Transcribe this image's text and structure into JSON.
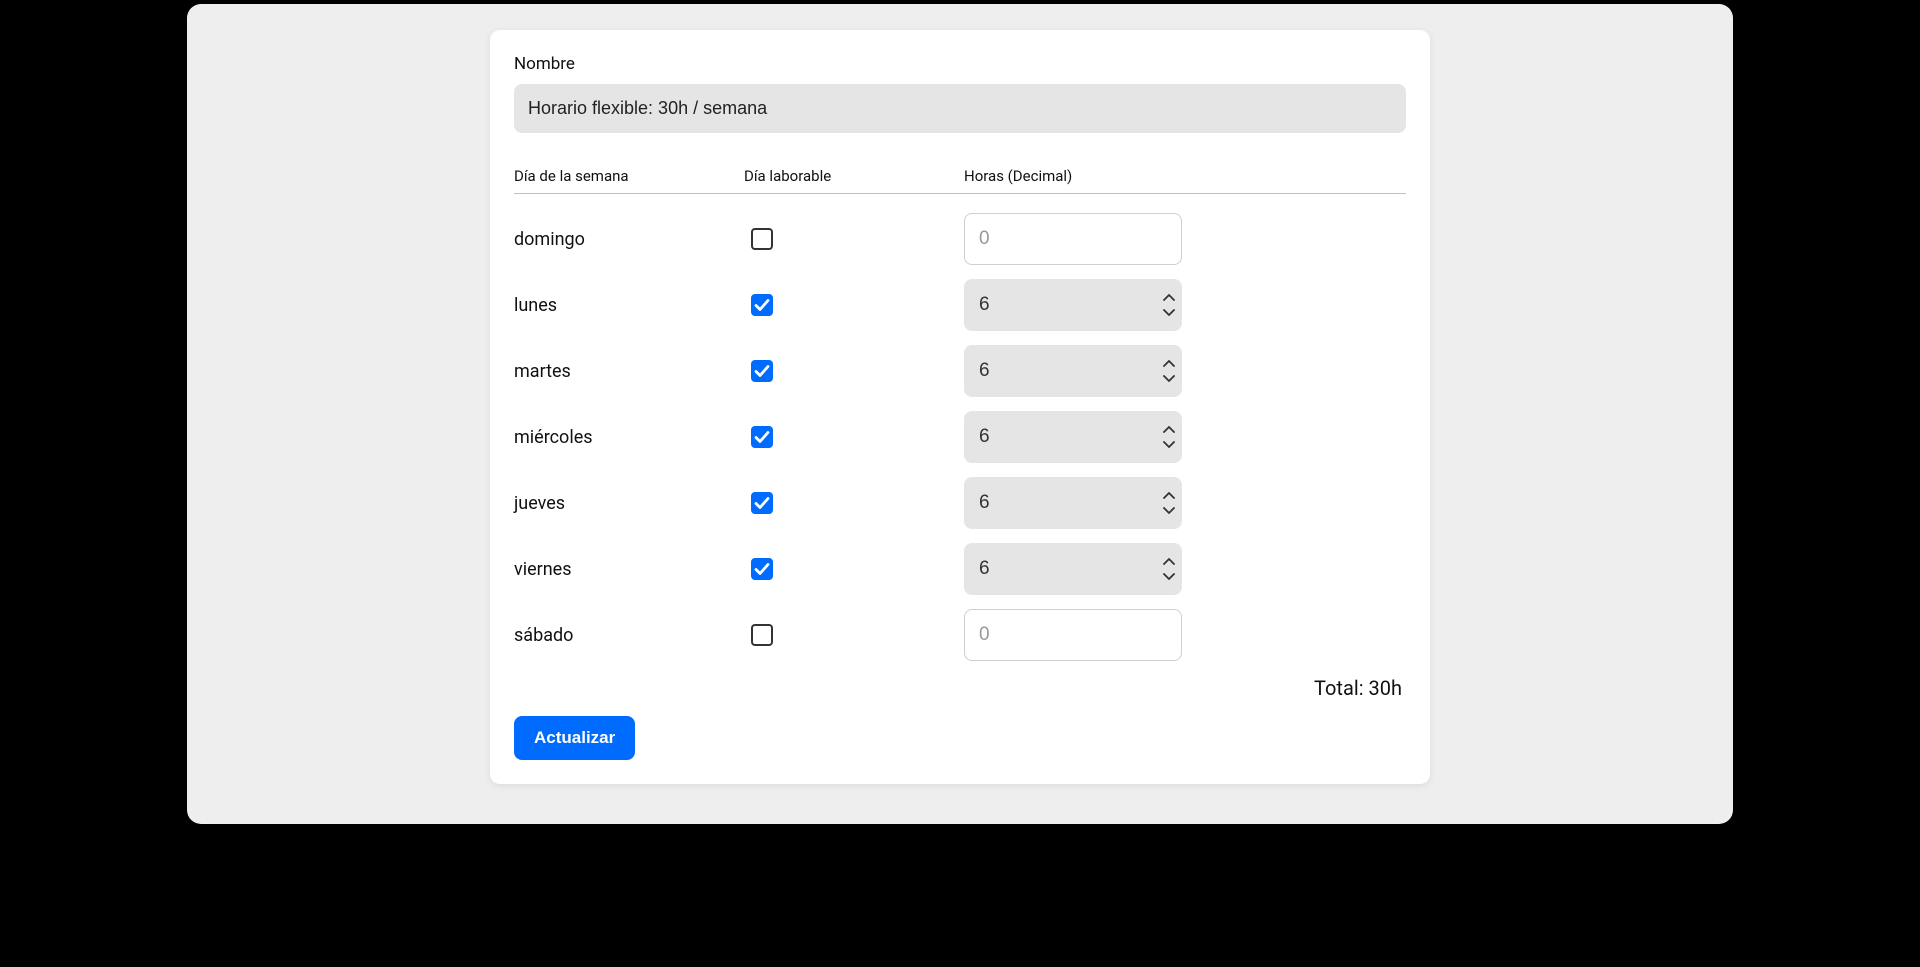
{
  "form": {
    "name_label": "Nombre",
    "name_value": "Horario flexible: 30h / semana",
    "headers": {
      "day": "Día de la semana",
      "workday": "Día laborable",
      "hours": "Horas (Decimal)"
    },
    "days": [
      {
        "name": "domingo",
        "workday": false,
        "hours": "",
        "placeholder": "0"
      },
      {
        "name": "lunes",
        "workday": true,
        "hours": "6",
        "placeholder": ""
      },
      {
        "name": "martes",
        "workday": true,
        "hours": "6",
        "placeholder": ""
      },
      {
        "name": "miércoles",
        "workday": true,
        "hours": "6",
        "placeholder": ""
      },
      {
        "name": "jueves",
        "workday": true,
        "hours": "6",
        "placeholder": ""
      },
      {
        "name": "viernes",
        "workday": true,
        "hours": "6",
        "placeholder": ""
      },
      {
        "name": "sábado",
        "workday": false,
        "hours": "",
        "placeholder": "0"
      }
    ],
    "total_label": "Total: 30h",
    "update_label": "Actualizar"
  },
  "colors": {
    "accent": "#006cff"
  }
}
